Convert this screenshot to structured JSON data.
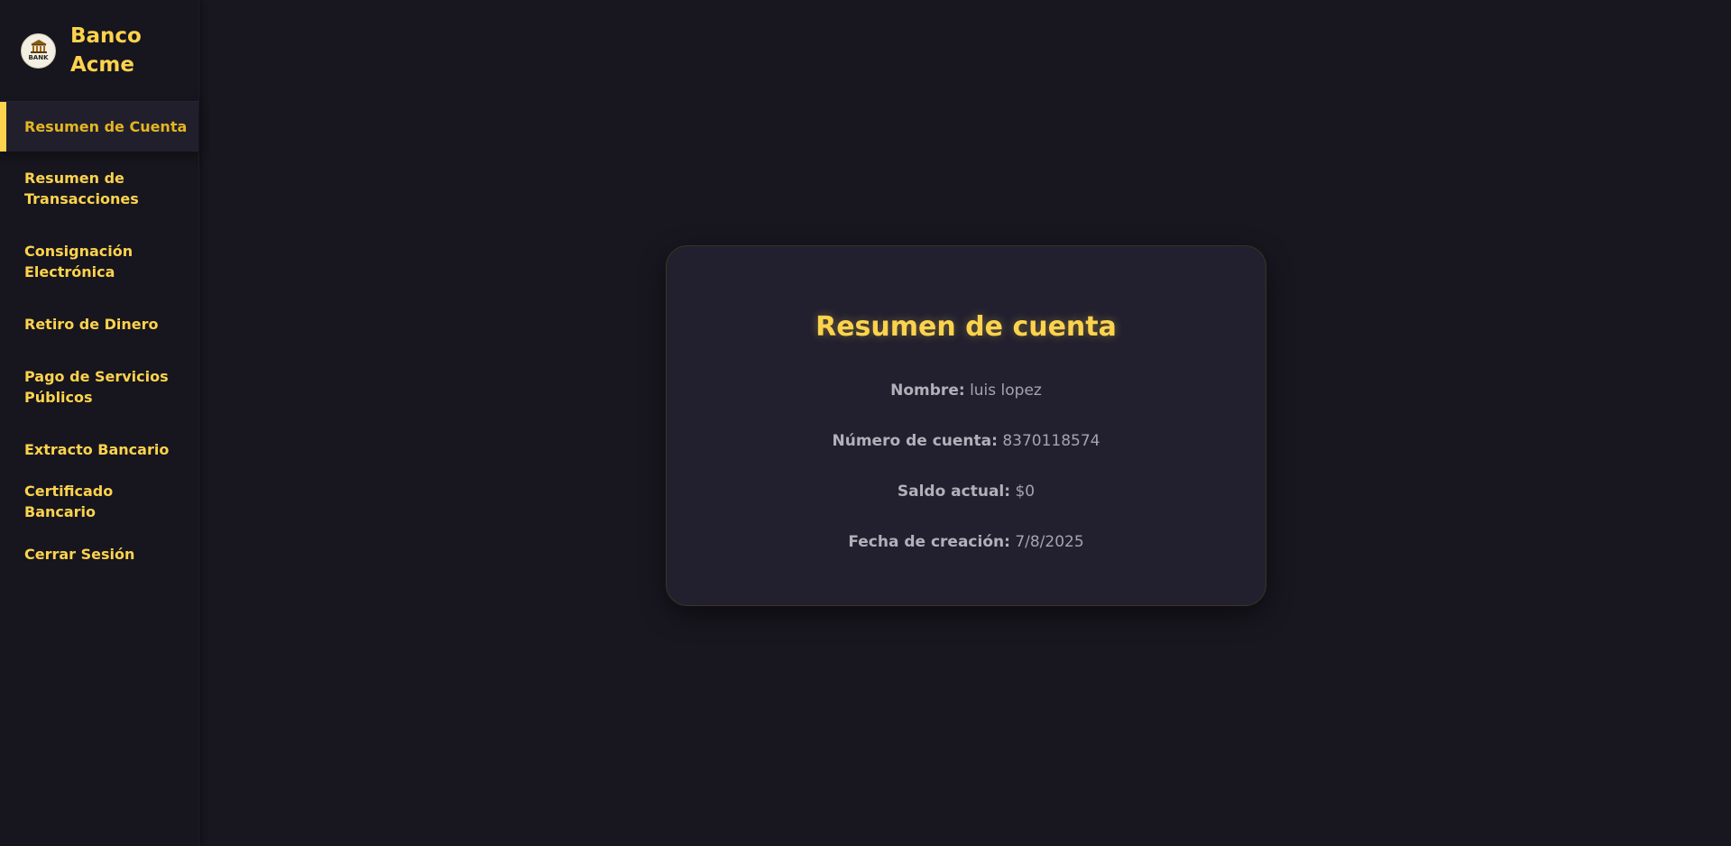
{
  "brand": {
    "logo_text": "BANK",
    "name": "Banco Acme"
  },
  "sidebar": {
    "items": [
      {
        "label": "Resumen de Cuenta",
        "active": true
      },
      {
        "label": "Resumen de Transacciones",
        "active": false
      },
      {
        "label": "Consignación Electrónica",
        "active": false
      },
      {
        "label": "Retiro de Dinero",
        "active": false
      },
      {
        "label": "Pago de Servicios Públicos",
        "active": false
      },
      {
        "label": "Extracto Bancario",
        "active": false
      },
      {
        "label": "Certificado Bancario",
        "active": false
      },
      {
        "label": "Cerrar Sesión",
        "active": false
      }
    ]
  },
  "card": {
    "title": "Resumen de cuenta",
    "fields": [
      {
        "label": "Nombre:",
        "value": "luis lopez"
      },
      {
        "label": "Número de cuenta:",
        "value": "8370118574"
      },
      {
        "label": "Saldo actual:",
        "value": "$0"
      },
      {
        "label": "Fecha de creación:",
        "value": "7/8/2025"
      }
    ]
  },
  "colors": {
    "accent": "#fcd34d",
    "background": "#18161f",
    "card": "#22202f"
  }
}
